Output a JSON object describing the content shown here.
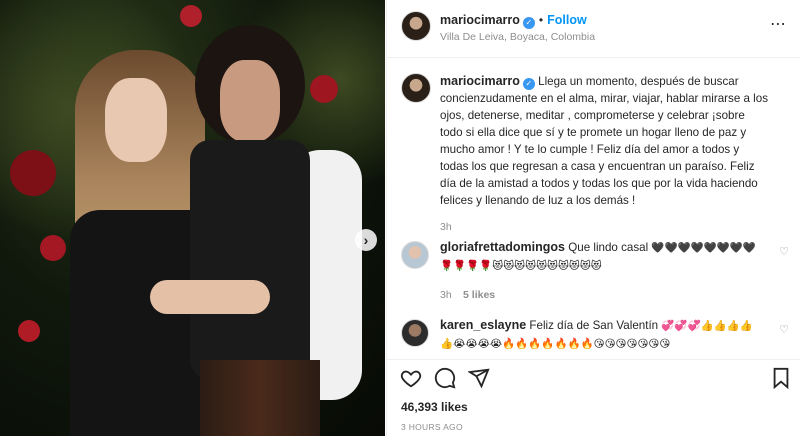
{
  "post": {
    "username": "mariocimarro",
    "follow_label": "Follow",
    "location": "Villa De Leiva, Boyaca, Colombia",
    "next_icon": "chevron-right-icon"
  },
  "caption": {
    "username": "mariocimarro",
    "text": "Llega un momento, después de buscar concienzudamente en el alma, mirar, viajar, hablar mirarse a los ojos, detenerse, meditar , comprometerse y celebrar ¡sobre todo si ella dice que sí y te promete un hogar lleno de paz y mucho amor ! Y te lo cumple ! Feliz día del amor a todos y todas los que regresan a casa y encuentran un paraíso. Feliz día de la amistad a todos y todas los que por la vida haciendo felices y llenando de luz a los demás !",
    "time": "3h"
  },
  "comments": [
    {
      "username": "gloriafrettadomingos",
      "text": "Que lindo casal",
      "emoji": "🖤🖤🖤🖤🖤🖤🖤🖤🌹🌹🌹🌹😻😻😻😻😻😻😻😻😻😻",
      "time": "3h",
      "likes": "5 likes"
    },
    {
      "username": "karen_eslayne",
      "text": "Feliz día de San Valentín",
      "emoji": "💞💞💞👍👍👍👍👍😭😭😭😭🔥🔥🔥🔥🔥🔥🔥😘😘😘😘😘😘😘",
      "time": "",
      "likes": ""
    }
  ],
  "actions": {
    "like_icon": "heart-icon",
    "comment_icon": "comment-icon",
    "share_icon": "share-icon",
    "save_icon": "bookmark-icon"
  },
  "likes_label": "46,393 likes",
  "timestamp": "3 HOURS AGO",
  "colors": {
    "accent": "#0095f6",
    "verified": "#3897f0",
    "secondary_text": "#8e8e8e"
  }
}
